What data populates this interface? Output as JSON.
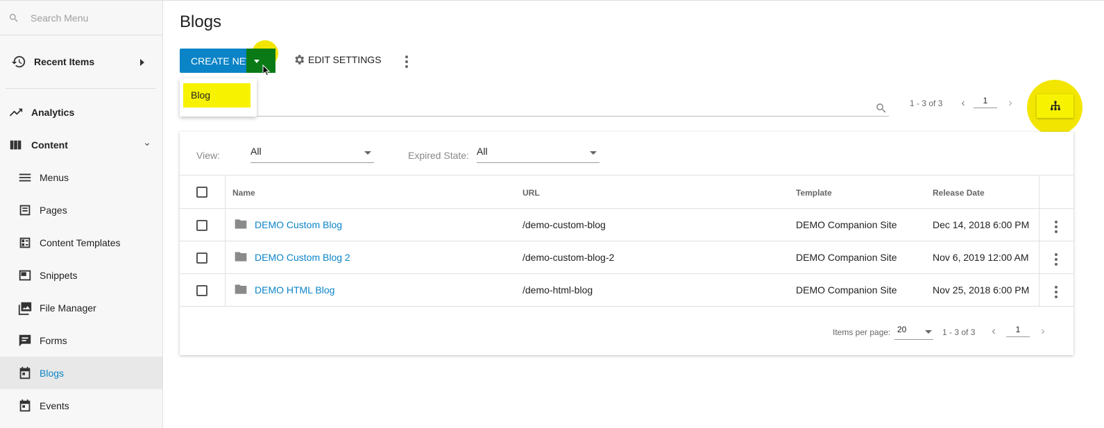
{
  "sidebar": {
    "search_placeholder": "Search Menu",
    "recent_label": "Recent Items",
    "analytics_label": "Analytics",
    "content_label": "Content",
    "items": [
      {
        "label": "Menus",
        "icon": "menu-icon"
      },
      {
        "label": "Pages",
        "icon": "page-icon"
      },
      {
        "label": "Content Templates",
        "icon": "template-icon"
      },
      {
        "label": "Snippets",
        "icon": "snippet-icon"
      },
      {
        "label": "File Manager",
        "icon": "images-icon"
      },
      {
        "label": "Forms",
        "icon": "form-icon"
      },
      {
        "label": "Blogs",
        "icon": "calendar-icon",
        "active": true
      },
      {
        "label": "Events",
        "icon": "calendar-icon"
      }
    ]
  },
  "header": {
    "title": "Blogs",
    "create_label": "CREATE NEW",
    "edit_label": "EDIT SETTINGS",
    "dropdown_option": "Blog"
  },
  "pager_top": {
    "range": "1 - 3 of 3",
    "page": "1"
  },
  "filters": {
    "view_label": "View:",
    "view_value": "All",
    "expired_label": "Expired State:",
    "expired_value": "All"
  },
  "table": {
    "columns": [
      "Name",
      "URL",
      "Template",
      "Release Date"
    ],
    "rows": [
      {
        "name": "DEMO Custom Blog",
        "url": "/demo-custom-blog",
        "template": "DEMO Companion Site",
        "date": "Dec 14, 2018 6:00 PM"
      },
      {
        "name": "DEMO Custom Blog 2",
        "url": "/demo-custom-blog-2",
        "template": "DEMO Companion Site",
        "date": "Nov 6, 2019 12:00 AM"
      },
      {
        "name": "DEMO HTML Blog",
        "url": "/demo-html-blog",
        "template": "DEMO Companion Site",
        "date": "Nov 25, 2018 6:00 PM"
      }
    ]
  },
  "footer": {
    "items_per_page_label": "Items per page:",
    "items_per_page": "20",
    "range": "1 - 3 of 3",
    "page": "1"
  },
  "colors": {
    "accent": "#0b84c7",
    "highlight": "#f2e600",
    "active_green": "#0a7a17"
  }
}
